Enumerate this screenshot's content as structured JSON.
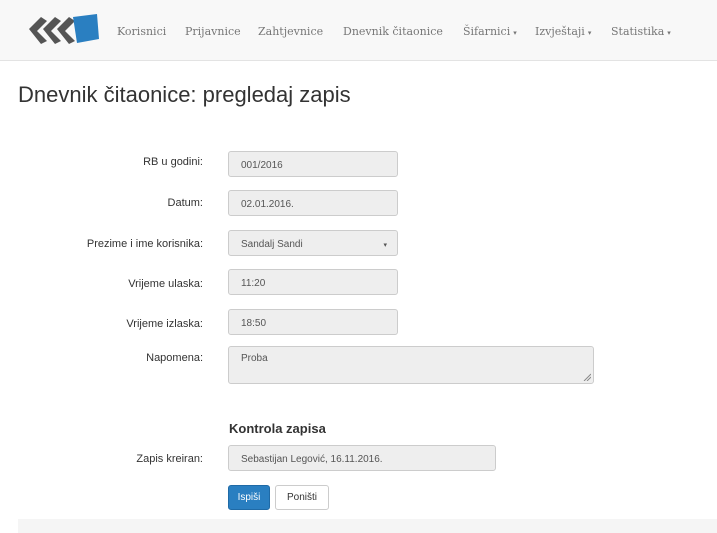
{
  "nav": {
    "items": [
      {
        "label": "Korisnici",
        "dropdown": false
      },
      {
        "label": "Prijavnice",
        "dropdown": false
      },
      {
        "label": "Zahtjevnice",
        "dropdown": false
      },
      {
        "label": "Dnevnik čitaonice",
        "dropdown": false
      },
      {
        "label": "Šifarnici",
        "dropdown": true
      },
      {
        "label": "Izvještaji",
        "dropdown": true
      },
      {
        "label": "Statistika",
        "dropdown": true
      }
    ],
    "caret": "▾"
  },
  "page": {
    "title": "Dnevnik čitaonice: pregledaj zapis"
  },
  "form": {
    "rb_label": "RB u godini:",
    "rb_value": "001/2016",
    "datum_label": "Datum:",
    "datum_value": "02.01.2016.",
    "korisnik_label": "Prezime i ime korisnika:",
    "korisnik_value": "Sandalj Sandi",
    "select_arrow": "▾",
    "ulazak_label": "Vrijeme ulaska:",
    "ulazak_value": "11:20",
    "izlazak_label": "Vrijeme izlaska:",
    "izlazak_value": "18:50",
    "napomena_label": "Napomena:",
    "napomena_value": "Proba"
  },
  "kontrola": {
    "title": "Kontrola zapisa",
    "kreiran_label": "Zapis kreiran:",
    "kreiran_value": "Sebastijan Legović, 16.11.2016."
  },
  "buttons": {
    "primary": "Ispiši",
    "secondary": "Poništi"
  },
  "colors": {
    "logo": "#555555",
    "logo_accent": "#2a7fc1",
    "primary": "#2a7fc1"
  }
}
